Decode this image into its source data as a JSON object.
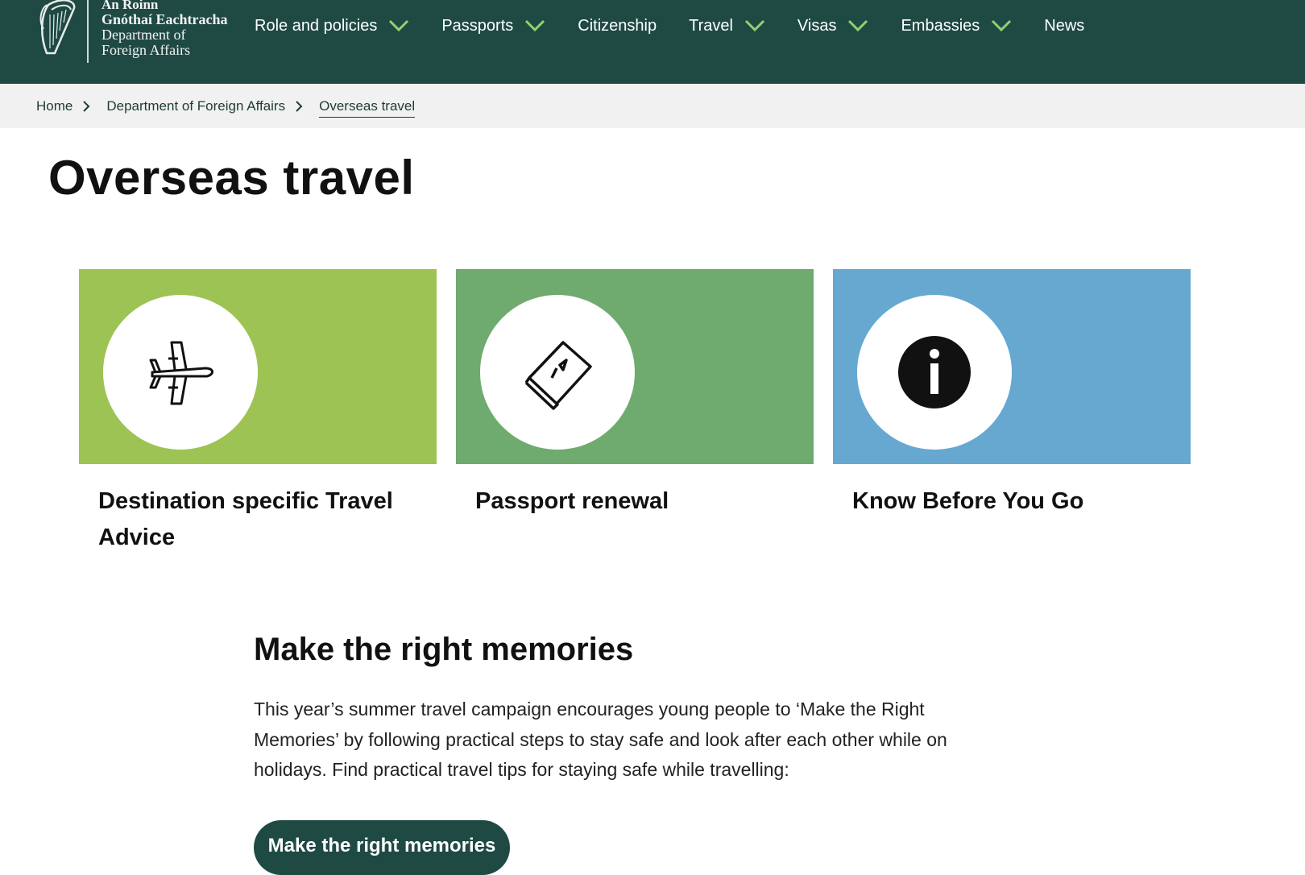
{
  "header": {
    "logo_lines": [
      "An Roinn",
      "Gnóthaí Eachtracha",
      "Department of",
      "Foreign Affairs"
    ],
    "nav": [
      {
        "label": "Role and policies",
        "has_dropdown": true
      },
      {
        "label": "Passports",
        "has_dropdown": true
      },
      {
        "label": "Citizenship",
        "has_dropdown": false
      },
      {
        "label": "Travel",
        "has_dropdown": true
      },
      {
        "label": "Visas",
        "has_dropdown": true
      },
      {
        "label": "Embassies",
        "has_dropdown": true
      },
      {
        "label": "News",
        "has_dropdown": false
      }
    ],
    "colors": {
      "background": "#1f4a44",
      "chevron": "#8fd36e"
    }
  },
  "breadcrumb": [
    "Home",
    "Department of Foreign Affairs",
    "Overseas travel"
  ],
  "page_title": "Overseas travel",
  "cards": [
    {
      "title": "Destination specific Travel Advice",
      "icon": "airplane-icon",
      "color": "#9dc355"
    },
    {
      "title": "Passport renewal",
      "icon": "passport-icon",
      "color": "#6fab6e"
    },
    {
      "title": "Know Before You Go",
      "icon": "info-icon",
      "color": "#66a8d0"
    }
  ],
  "section": {
    "heading": "Make the right memories",
    "body": "This year’s summer travel campaign encourages young people to ‘Make the Right Memories’ by following practical steps to stay safe and look after each other while on holidays. Find practical travel tips for staying safe while travelling:",
    "button_label": "Make the right memories"
  }
}
